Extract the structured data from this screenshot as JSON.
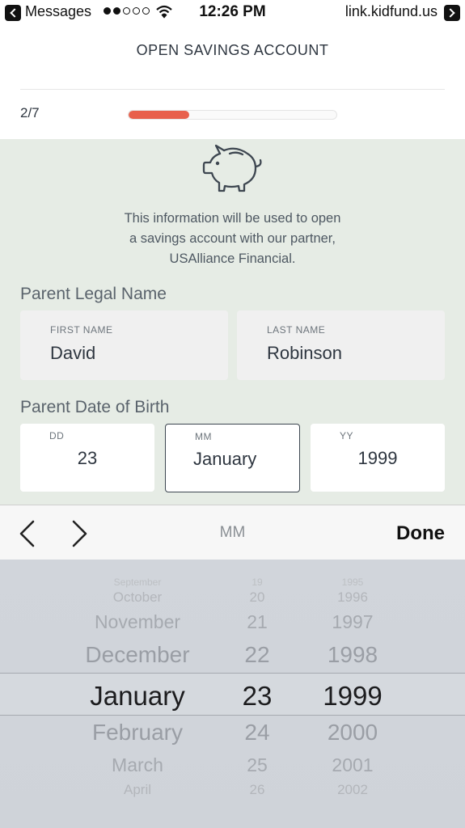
{
  "status_bar": {
    "back_app": "Messages",
    "signal_dots": [
      true,
      true,
      false,
      false,
      false
    ],
    "time": "12:26 PM",
    "url": "link.kidfund.us",
    "icons": [
      "back-arrow-icon",
      "wifi-icon",
      "forward-arrow-icon"
    ]
  },
  "header": {
    "title": "OPEN SAVINGS ACCOUNT",
    "step": "2/7",
    "progress_fraction": 0.29
  },
  "form": {
    "icon": "piggy-bank-icon",
    "info_text": "This information will be used to open a savings account with our partner, USAlliance Financial.",
    "info_lines": [
      "This information will be used to open",
      "a savings account with our partner,",
      "USAlliance Financial."
    ],
    "parent_name_label": "Parent Legal Name",
    "first_name": {
      "label": "FIRST NAME",
      "value": "David"
    },
    "last_name": {
      "label": "LAST NAME",
      "value": "Robinson"
    },
    "dob_label": "Parent Date of Birth",
    "dd": {
      "label": "DD",
      "value": "23"
    },
    "mm": {
      "label": "MM",
      "value": "January"
    },
    "yy": {
      "label": "YY",
      "value": "1999"
    }
  },
  "accessory": {
    "title": "MM",
    "done_label": "Done",
    "icons": [
      "chevron-left-icon",
      "chevron-right-icon"
    ]
  },
  "picker": {
    "months": [
      "September",
      "October",
      "November",
      "December",
      "January",
      "February",
      "March",
      "April"
    ],
    "days": [
      "19",
      "20",
      "21",
      "22",
      "23",
      "24",
      "25",
      "26"
    ],
    "years": [
      "1995",
      "1996",
      "1997",
      "1998",
      "1999",
      "2000",
      "2001",
      "2002"
    ],
    "selected_index": 4
  },
  "colors": {
    "accent": "#e8604c",
    "form_background": "#e6ece5",
    "picker_background": "#d1d5db"
  }
}
